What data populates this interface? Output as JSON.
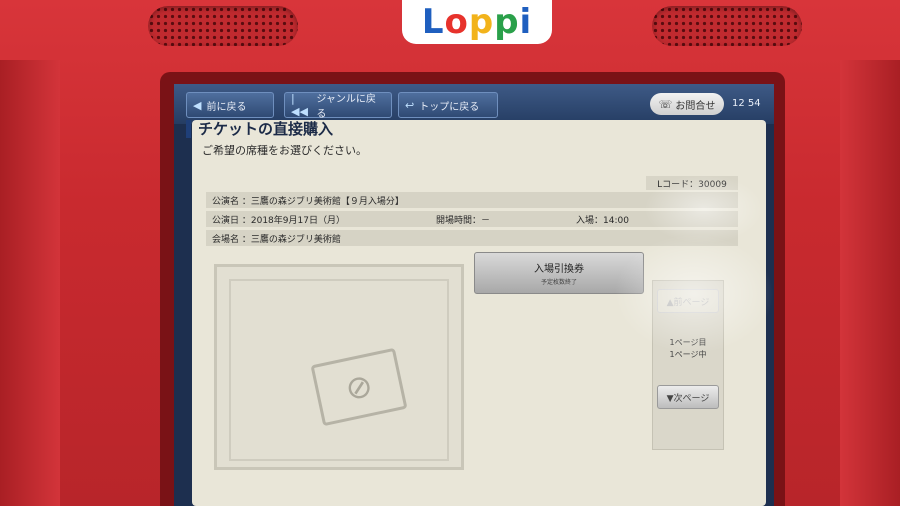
{
  "device": {
    "logo_text": "Loppi"
  },
  "topbar": {
    "back_label": "前に戻る",
    "back_icon": "back-triangle-icon",
    "genre_label": "ジャンルに戻る",
    "genre_icon": "rewind-icon",
    "top_label": "トップに戻る",
    "top_icon": "return-arrow-icon",
    "contact_label": "お問合せ",
    "contact_icon": "phone-icon",
    "clock": "12 54"
  },
  "main": {
    "title": "チケットの直接購入",
    "subtitle": "ご希望の席種をお選びください。",
    "lcode": "Lコード：30009",
    "performance_name": "公演名 ：三鷹の森ジブリ美術館【９月入場分】",
    "performance_date": "公演日 ：2018年9月17日（月）",
    "open_time": "開場時間：－",
    "entry_time": "入場：14:00",
    "venue": "会場名 ：三鷹の森ジブリ美術館",
    "enter_ticket_label": "入場引換券",
    "enter_ticket_sub": "予定枚数終了",
    "image_icon": "no-image-icon"
  },
  "pager": {
    "prev_label": "▲前ページ",
    "page_info_line1": "1ページ目",
    "page_info_line2": "1ページ中",
    "next_label": "▼次ページ"
  },
  "colors": {
    "housing": "#c92a2f",
    "topbar": "#2f4a74",
    "content_bg": "#e9e6d8",
    "title": "#1b2a47"
  }
}
